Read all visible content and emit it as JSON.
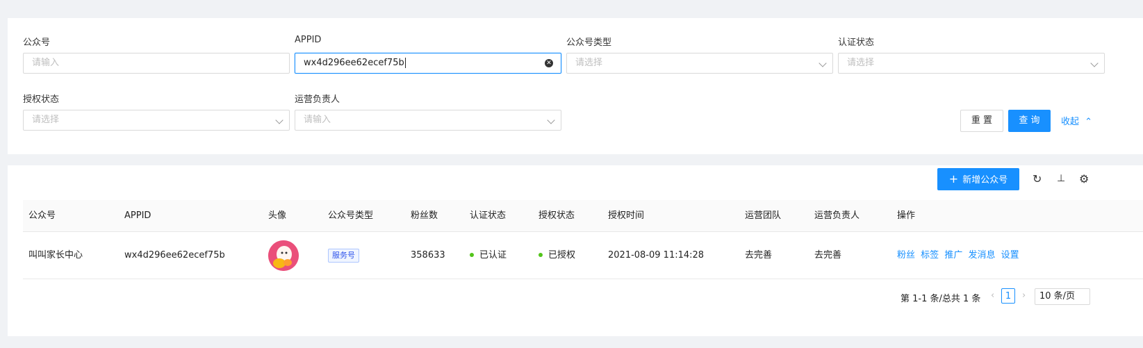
{
  "filters": {
    "account": {
      "label": "公众号",
      "placeholder": "请输入"
    },
    "appid": {
      "label": "APPID",
      "value": "wx4d296ee62ecef75b"
    },
    "account_type": {
      "label": "公众号类型",
      "placeholder": "请选择"
    },
    "verify_status": {
      "label": "认证状态",
      "placeholder": "请选择"
    },
    "auth_status": {
      "label": "授权状态",
      "placeholder": "请选择"
    },
    "operator": {
      "label": "运营负责人",
      "placeholder": "请输入"
    },
    "reset_label": "重 置",
    "search_label": "查 询",
    "collapse_label": "收起"
  },
  "toolbar": {
    "add_label": "新增公众号",
    "icons": [
      "refresh-icon",
      "vertical-align-icon",
      "settings-icon"
    ]
  },
  "table": {
    "columns": [
      "公众号",
      "APPID",
      "头像",
      "公众号类型",
      "粉丝数",
      "认证状态",
      "授权状态",
      "授权时间",
      "运营团队",
      "运营负责人",
      "操作"
    ],
    "rows": [
      {
        "name": "叫叫家长中心",
        "appid": "wx4d296ee62ecef75b",
        "type": "服务号",
        "fans": "358633",
        "verify": "已认证",
        "auth": "已授权",
        "auth_time": "2021-08-09 11:14:28",
        "team": "去完善",
        "owner": "去完善",
        "actions": [
          "粉丝",
          "标签",
          "推广",
          "发消息",
          "设置"
        ]
      }
    ]
  },
  "pagination": {
    "summary": "第 1-1 条/总共 1 条",
    "current": "1",
    "page_size": "10 条/页"
  },
  "colors": {
    "primary": "#1890ff",
    "success": "#52c41a",
    "background": "#f0f2f5"
  }
}
